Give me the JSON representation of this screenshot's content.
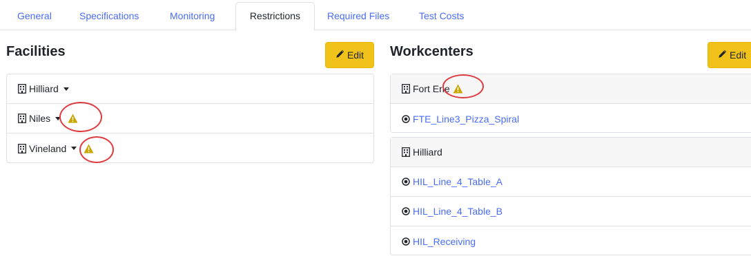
{
  "tabs": [
    {
      "label": "General"
    },
    {
      "label": "Specifications"
    },
    {
      "label": "Monitoring"
    },
    {
      "label": "Restrictions",
      "active": true
    },
    {
      "label": "Required Files"
    },
    {
      "label": "Test Costs"
    }
  ],
  "facilities": {
    "title": "Facilities",
    "edit_label": "Edit",
    "items": [
      {
        "label": "Hilliard",
        "warning": false
      },
      {
        "label": "Niles",
        "warning": true
      },
      {
        "label": "Vineland",
        "warning": true
      }
    ]
  },
  "workcenters": {
    "title": "Workcenters",
    "edit_label": "Edit",
    "groups": [
      {
        "facility": "Fort Erie",
        "warning": true,
        "items": [
          "FTE_Line3_Pizza_Spiral"
        ]
      },
      {
        "facility": "Hilliard",
        "warning": false,
        "items": [
          "HIL_Line_4_Table_A",
          "HIL_Line_4_Table_B",
          "HIL_Receiving"
        ]
      }
    ]
  },
  "icons": {
    "building": "building-icon",
    "warning": "warning-icon",
    "workcenter": "dot-circle-icon",
    "edit": "pencil-icon"
  },
  "colors": {
    "link": "#4a6cf7",
    "edit_button": "#f0c21a",
    "warning": "#c9a600",
    "annotation": "#e0393e"
  }
}
